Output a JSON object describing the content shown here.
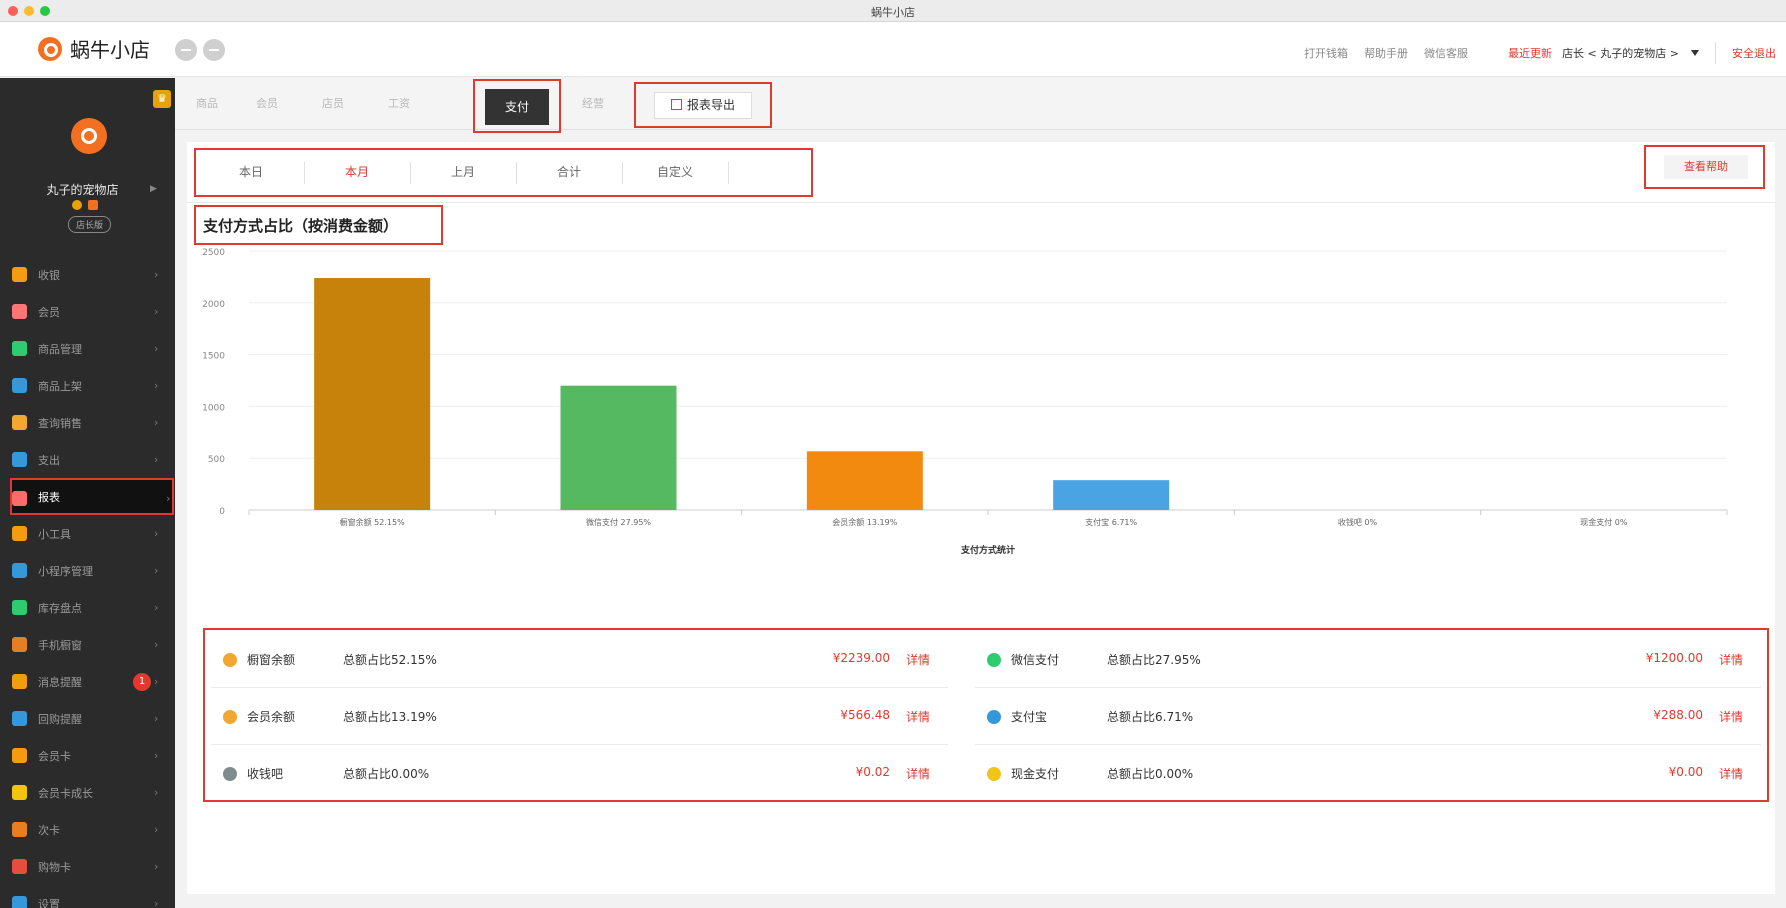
{
  "window": {
    "title": "蜗牛小店"
  },
  "header": {
    "logo_text": "蜗牛小店",
    "links": {
      "wallet": "打开钱箱",
      "manual": "帮助手册",
      "wechat_service": "微信客服",
      "update": "最近更新",
      "store": "店长 < 丸子的宠物店 >",
      "logout": "安全退出"
    }
  },
  "sidebar": {
    "shop_name": "丸子的宠物店",
    "role": "店长版",
    "items": [
      {
        "label": "收银",
        "color": "#f39c12"
      },
      {
        "label": "会员",
        "color": "#ff7675"
      },
      {
        "label": "商品管理",
        "color": "#2ecc71"
      },
      {
        "label": "商品上架",
        "color": "#3498db"
      },
      {
        "label": "查询销售",
        "color": "#f0a830"
      },
      {
        "label": "支出",
        "color": "#3498db"
      },
      {
        "label": "报表",
        "color": "#ff6b6b"
      },
      {
        "label": "小工具",
        "color": "#f39c12"
      },
      {
        "label": "小程序管理",
        "color": "#3498db"
      },
      {
        "label": "库存盘点",
        "color": "#2ecc71"
      },
      {
        "label": "手机橱窗",
        "color": "#e67e22"
      },
      {
        "label": "消息提醒",
        "color": "#f39c12",
        "badge": "1"
      },
      {
        "label": "回购提醒",
        "color": "#3498db"
      },
      {
        "label": "会员卡",
        "color": "#f39c12"
      },
      {
        "label": "会员卡成长",
        "color": "#f1c40f"
      },
      {
        "label": "次卡",
        "color": "#e67e22"
      },
      {
        "label": "购物卡",
        "color": "#e74c3c"
      },
      {
        "label": "设置",
        "color": "#3498db"
      }
    ]
  },
  "tabs": {
    "goods": "商品",
    "member": "会员",
    "staff": "店员",
    "salary": "工资",
    "payment": "支付",
    "operation": "经营",
    "export": "报表导出"
  },
  "periods": [
    "本日",
    "本月",
    "上月",
    "合计",
    "自定义"
  ],
  "selected_period": "本月",
  "help_button": "查看帮助",
  "chart_data": {
    "type": "bar",
    "title": "支付方式占比（按消费金额）",
    "xlabel": "支付方式统计",
    "ylim": [
      0,
      2500
    ],
    "yticks": [
      0,
      500,
      1000,
      1500,
      2000,
      2500
    ],
    "categories": [
      "橱窗余额 52.15%",
      "微信支付 27.95%",
      "会员余额 13.19%",
      "支付宝 6.71%",
      "收钱吧 0%",
      "现金支付 0%"
    ],
    "values": [
      2239.0,
      1200.0,
      566.48,
      288.0,
      0.02,
      0.0
    ],
    "colors": [
      "#c6820a",
      "#55b962",
      "#f28a0f",
      "#4aa3e2",
      "#999999",
      "#999999"
    ],
    "grid": true
  },
  "payments": [
    {
      "name": "橱窗余额",
      "ratio": "总额占比52.15%",
      "amount": "¥2239.00",
      "detail": "详情",
      "icon_color": "#f0a830",
      "icon": "shop-icon"
    },
    {
      "name": "微信支付",
      "ratio": "总额占比27.95%",
      "amount": "¥1200.00",
      "detail": "详情",
      "icon_color": "#2ecc71",
      "icon": "wechat-icon"
    },
    {
      "name": "会员余额",
      "ratio": "总额占比13.19%",
      "amount": "¥566.48",
      "detail": "详情",
      "icon_color": "#f0a830",
      "icon": "member-balance-icon"
    },
    {
      "name": "支付宝",
      "ratio": "总额占比6.71%",
      "amount": "¥288.00",
      "detail": "详情",
      "icon_color": "#3498db",
      "icon": "alipay-icon"
    },
    {
      "name": "收钱吧",
      "ratio": "总额占比0.00%",
      "amount": "¥0.02",
      "detail": "详情",
      "icon_color": "#7f8c8d",
      "icon": "shouqianba-icon"
    },
    {
      "name": "现金支付",
      "ratio": "总额占比0.00%",
      "amount": "¥0.00",
      "detail": "详情",
      "icon_color": "#f0c419",
      "icon": "cash-icon"
    }
  ]
}
